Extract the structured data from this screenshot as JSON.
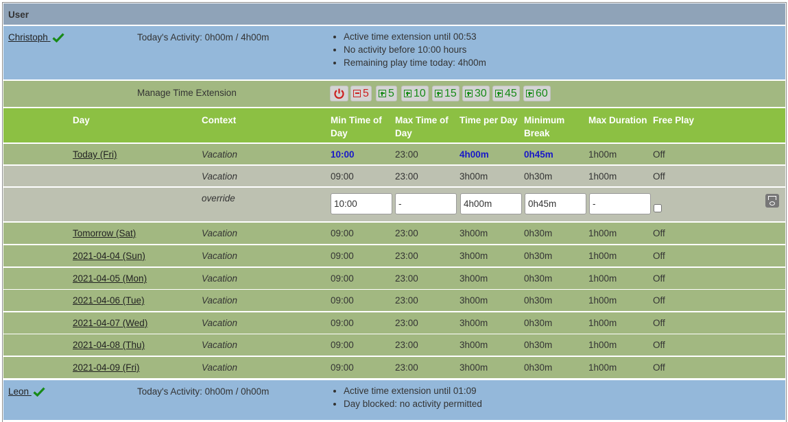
{
  "table_header": "User",
  "users": [
    {
      "name": "Christoph",
      "activity": "Today's Activity: 0h00m / 4h00m",
      "notes": [
        "Active time extension until 00:53",
        "No activity before 10:00 hours",
        "Remaining play time today: 4h00m"
      ]
    },
    {
      "name": "Leon",
      "activity": "Today's Activity: 0h00m / 0h00m",
      "notes": [
        "Active time extension until 01:09",
        "Day blocked: no activity permitted"
      ]
    }
  ],
  "manage_extension": {
    "label": "Manage Time Extension",
    "minus_label": "5",
    "plus_labels": [
      "5",
      "10",
      "15",
      "30",
      "45",
      "60"
    ]
  },
  "columns": [
    "Day",
    "Context",
    "Min Time of Day",
    "Max Time of Day",
    "Time per Day",
    "Minimum Break",
    "Max Duration",
    "Free Play"
  ],
  "rows": [
    {
      "day": "Today (Fri)",
      "context": "Vacation",
      "min": "10:00",
      "max": "23:00",
      "tpd": "4h00m",
      "brk": "0h45m",
      "dur": "1h00m",
      "free": "Off"
    },
    {
      "day": "",
      "context": "Vacation",
      "min": "09:00",
      "max": "23:00",
      "tpd": "3h00m",
      "brk": "0h30m",
      "dur": "1h00m",
      "free": "Off"
    },
    {
      "day": "Tomorrow (Sat)",
      "context": "Vacation",
      "min": "09:00",
      "max": "23:00",
      "tpd": "3h00m",
      "brk": "0h30m",
      "dur": "1h00m",
      "free": "Off"
    },
    {
      "day": "2021-04-04 (Sun)",
      "context": "Vacation",
      "min": "09:00",
      "max": "23:00",
      "tpd": "3h00m",
      "brk": "0h30m",
      "dur": "1h00m",
      "free": "Off"
    },
    {
      "day": "2021-04-05 (Mon)",
      "context": "Vacation",
      "min": "09:00",
      "max": "23:00",
      "tpd": "3h00m",
      "brk": "0h30m",
      "dur": "1h00m",
      "free": "Off"
    },
    {
      "day": "2021-04-06 (Tue)",
      "context": "Vacation",
      "min": "09:00",
      "max": "23:00",
      "tpd": "3h00m",
      "brk": "0h30m",
      "dur": "1h00m",
      "free": "Off"
    },
    {
      "day": "2021-04-07 (Wed)",
      "context": "Vacation",
      "min": "09:00",
      "max": "23:00",
      "tpd": "3h00m",
      "brk": "0h30m",
      "dur": "1h00m",
      "free": "Off"
    },
    {
      "day": "2021-04-08 (Thu)",
      "context": "Vacation",
      "min": "09:00",
      "max": "23:00",
      "tpd": "3h00m",
      "brk": "0h30m",
      "dur": "1h00m",
      "free": "Off"
    },
    {
      "day": "2021-04-09 (Fri)",
      "context": "Vacation",
      "min": "09:00",
      "max": "23:00",
      "tpd": "3h00m",
      "brk": "0h30m",
      "dur": "1h00m",
      "free": "Off"
    }
  ],
  "override": {
    "context": "override",
    "min": "10:00",
    "max": "-",
    "tpd": "4h00m",
    "brk": "0h45m",
    "dur": "-",
    "free_play_checked": false
  },
  "colors": {
    "highlight": "#1818c8",
    "check": "#178a17",
    "minus": "#cc1f1f",
    "plus": "#178a17"
  }
}
